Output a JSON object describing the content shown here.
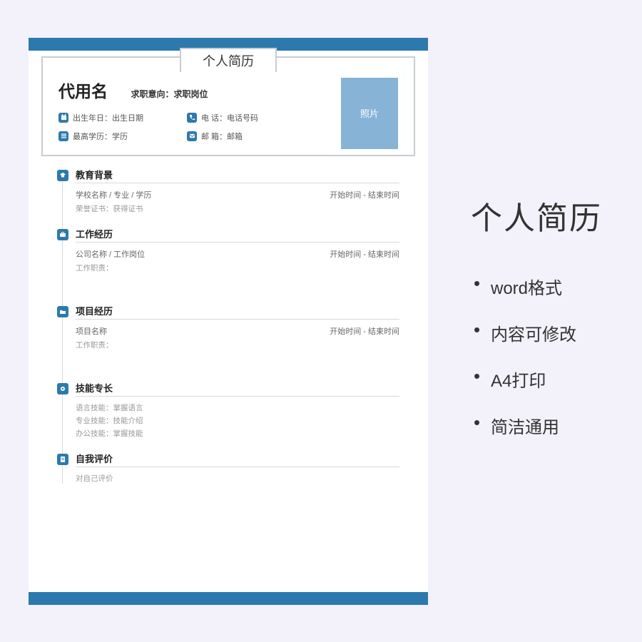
{
  "side": {
    "title": "个人简历",
    "features": [
      "word格式",
      "内容可修改",
      "A4打印",
      "简洁通用"
    ]
  },
  "resume": {
    "doc_title": "个人简历",
    "name": "代用名",
    "intention_label": "求职意向：求职岗位",
    "photo_label": "照片",
    "info": {
      "birth": "出生年日：出生日期",
      "phone": "电 话：电话号码",
      "edu": "最高学历：学历",
      "email": "邮 箱：邮箱"
    },
    "sections": {
      "education": {
        "title": "教育背景",
        "main": "学校名称 / 专业 / 学历",
        "time": "开始时间 - 结束时间",
        "sub": "荣誉证书：获得证书"
      },
      "work": {
        "title": "工作经历",
        "main": "公司名称 / 工作岗位",
        "time": "开始时间 - 结束时间",
        "sub": "工作职责："
      },
      "project": {
        "title": "项目经历",
        "main": "项目名称",
        "time": "开始时间 - 结束时间",
        "sub": "工作职责："
      },
      "skills": {
        "title": "技能专长",
        "lines": [
          "语言技能：掌握语言",
          "专业技能：技能介绍",
          "办公技能：掌握技能"
        ]
      },
      "self": {
        "title": "自我评价",
        "content": "对自己评价"
      }
    }
  }
}
